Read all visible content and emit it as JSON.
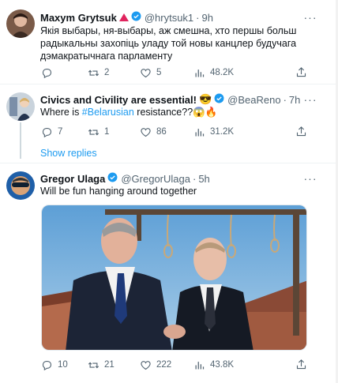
{
  "tweets": [
    {
      "display_name": "Maxym Grytsuk",
      "handle": "@hrytsuk1",
      "time": "9h",
      "text_lines": [
        "Якія выбары, ня-выбары, аж смешна, хто першы больш",
        "радыкальны захопіць уладу той новы канцлер будучага",
        "дэмакратычнага парламенту"
      ],
      "replies": "",
      "retweets": "2",
      "likes": "5",
      "views": "48.2K"
    },
    {
      "display_name": "Civics and Civility are essential!",
      "emoji": "😎",
      "handle": "@BeaReno",
      "time": "7h",
      "text_prefix": "Where is ",
      "hashtag": "#Belarusian",
      "text_suffix": " resistance??",
      "text_emoji": "😱🔥",
      "replies": "7",
      "retweets": "1",
      "likes": "86",
      "views": "31.2K"
    },
    {
      "display_name": "Gregor Ulaga",
      "handle": "@GregorUlaga",
      "time": "5h",
      "text": "Will be fun hanging around together",
      "replies": "10",
      "retweets": "21",
      "likes": "222",
      "views": "43.8K"
    }
  ],
  "show_replies": "Show replies",
  "separator": "·",
  "colors": {
    "accent": "#1d9bf0",
    "text": "#0f1419",
    "secondary": "#536471",
    "divider": "#eff3f4"
  },
  "icons": [
    "reply-icon",
    "retweet-icon",
    "like-icon",
    "views-icon",
    "share-icon",
    "more-icon",
    "verified-icon"
  ]
}
